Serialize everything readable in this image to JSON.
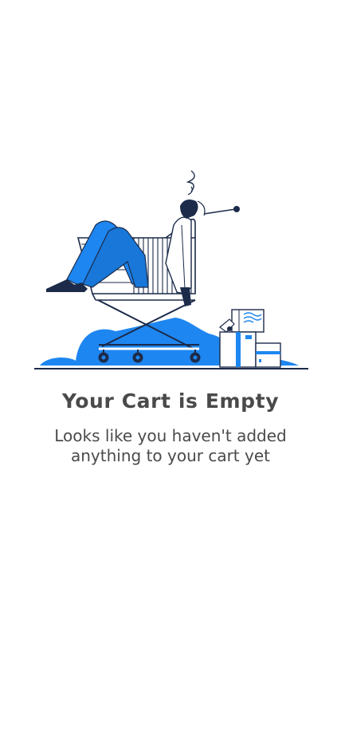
{
  "empty_state": {
    "title": "Your Cart is Empty",
    "message": "Looks like you haven't added anything to your cart yet",
    "illustration_icon": "person-in-shopping-cart-illustration"
  },
  "colors": {
    "accent_blue": "#1e86f0",
    "dark_navy": "#1c2b4a",
    "text_gray": "#4a4a4a",
    "background": "#ffffff"
  }
}
